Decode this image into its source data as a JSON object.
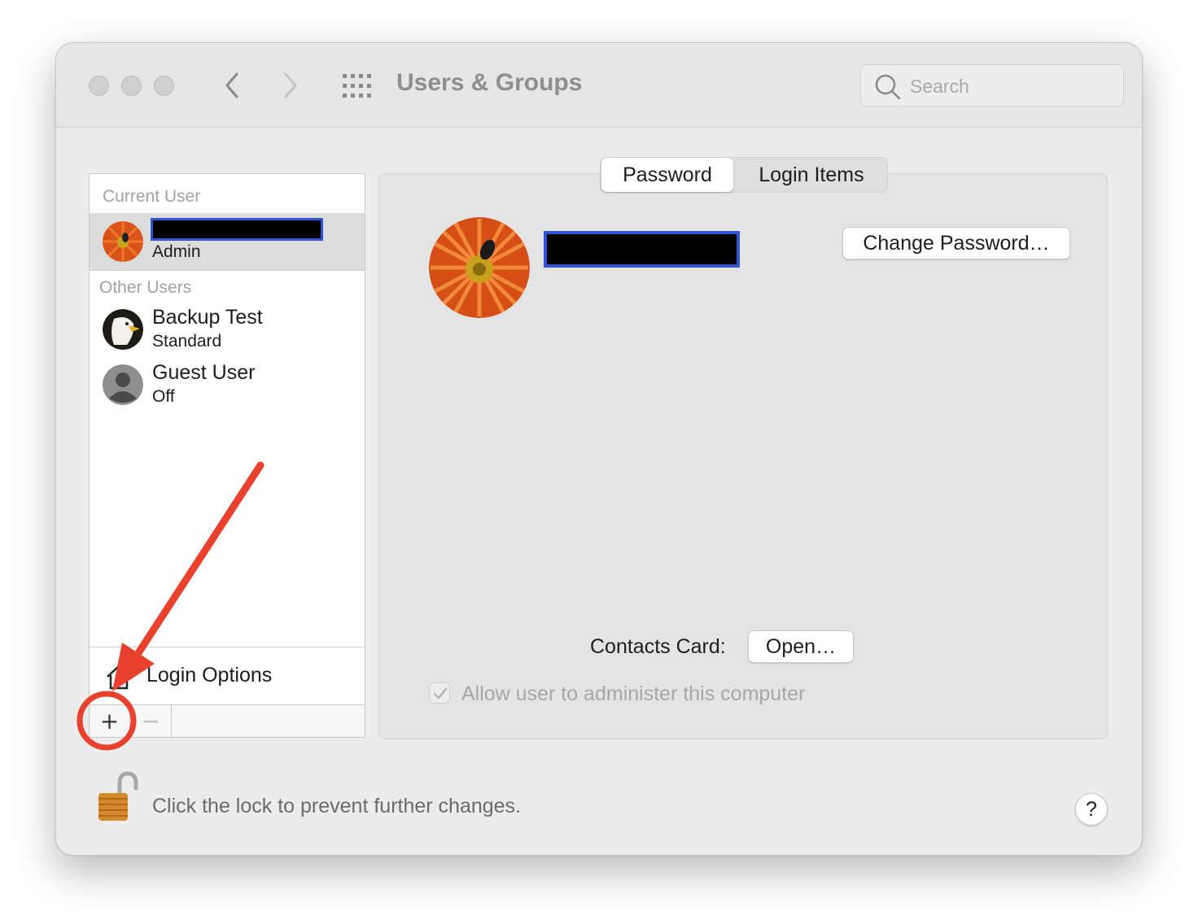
{
  "window": {
    "title": "Users & Groups"
  },
  "search": {
    "placeholder": "Search"
  },
  "sidebar": {
    "current_user_label": "Current User",
    "current_user": {
      "role": "Admin"
    },
    "other_users_label": "Other Users",
    "other_users": [
      {
        "name": "Backup Test",
        "role": "Standard"
      },
      {
        "name": "Guest User",
        "role": "Off"
      }
    ],
    "login_options_label": "Login Options",
    "add_label": "+",
    "remove_label": "−"
  },
  "tabs": [
    {
      "label": "Password",
      "active": true
    },
    {
      "label": "Login Items",
      "active": false
    }
  ],
  "main": {
    "change_password_label": "Change Password…",
    "contacts_card_label": "Contacts Card:",
    "open_label": "Open…",
    "admin_checkbox_label": "Allow user to administer this computer",
    "admin_checked": true
  },
  "footer": {
    "lock_text": "Click the lock to prevent further changes.",
    "help_label": "?"
  },
  "colors": {
    "redaction_border": "#2f55d4",
    "annotation": "#e8412e"
  }
}
